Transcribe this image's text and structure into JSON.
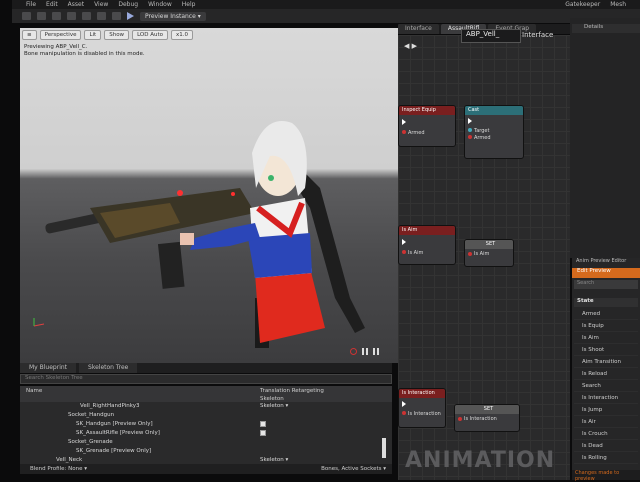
{
  "menu": {
    "items": [
      "File",
      "Edit",
      "Asset",
      "View",
      "Debug",
      "Window",
      "Help"
    ],
    "right": [
      "Gatekeeper",
      "Mesh"
    ]
  },
  "toolbar": {
    "preview_instance": "Preview Instance ▾"
  },
  "graph_tabs": [
    "Interface",
    "AssaultRifl",
    "Event Grap"
  ],
  "graph": {
    "title": "ABP_Vell_",
    "title_suffix": "Interface",
    "nodes": {
      "n1": {
        "title": "Inspect Equip",
        "pin": "Armed"
      },
      "n2": {
        "title": "Cast",
        "pins": [
          "Target",
          "Armed"
        ]
      },
      "n3": {
        "title": "Is Aim",
        "pin": "Is Aim"
      },
      "n4": {
        "title": "SET",
        "pin": "Is Aim"
      },
      "n5": {
        "title": "Is Interaction",
        "pin": "Is Interaction"
      },
      "n6": {
        "title": "SET",
        "pin": "Is Interaction"
      }
    },
    "watermark": "ANIMATION"
  },
  "viewport": {
    "buttons": [
      "Perspective",
      "Lit",
      "Show",
      "LOD Auto",
      "x1.0"
    ],
    "info_line1": "Previewing ABP_Vell_C.",
    "info_line2": "Bone manipulation is disabled in this mode."
  },
  "bottom_left": {
    "tabs": [
      "My Blueprint",
      "Skeleton Tree"
    ],
    "search_placeholder": "Search Skeleton Tree",
    "col_name": "Name",
    "col_translation": "Translation Retargeting",
    "col_skeleton": "Skeleton",
    "rows": [
      {
        "name": "Vell_RightHandPinky3",
        "col": "Skeleton ▾"
      },
      {
        "name": "Socket_Handgun",
        "col": ""
      },
      {
        "name": "SK_Handgun [Preview Only]",
        "col": ""
      },
      {
        "name": "SK_AssaultRifle [Preview Only]",
        "col": ""
      },
      {
        "name": "Socket_Grenade",
        "col": ""
      },
      {
        "name": "SK_Grenade [Preview Only]",
        "col": ""
      },
      {
        "name": "Vell_Neck",
        "col": "Skeleton ▾"
      }
    ],
    "footer_left": "Blend Profile: None ▾",
    "footer_right": "Bones, Active Sockets ▾"
  },
  "details": {
    "title": "Details"
  },
  "anim_preview": {
    "title": "Anim Preview Editor",
    "edit_label": "Edit Preview",
    "search_placeholder": "Search",
    "state_label": "State",
    "properties": [
      "Armed",
      "Is Equip",
      "Is Aim",
      "Is Shoot",
      "Aim Transition",
      "Is Reload",
      "Search",
      "Is Interaction",
      "Is Jump",
      "Is Air",
      "Is Crouch",
      "Is Dead",
      "Is Rolling"
    ],
    "footer": "Changes made to preview"
  },
  "colors": {
    "accent_orange": "#d56a1d",
    "node_red": "#7a1f1f",
    "node_teal": "#2c6f78"
  }
}
